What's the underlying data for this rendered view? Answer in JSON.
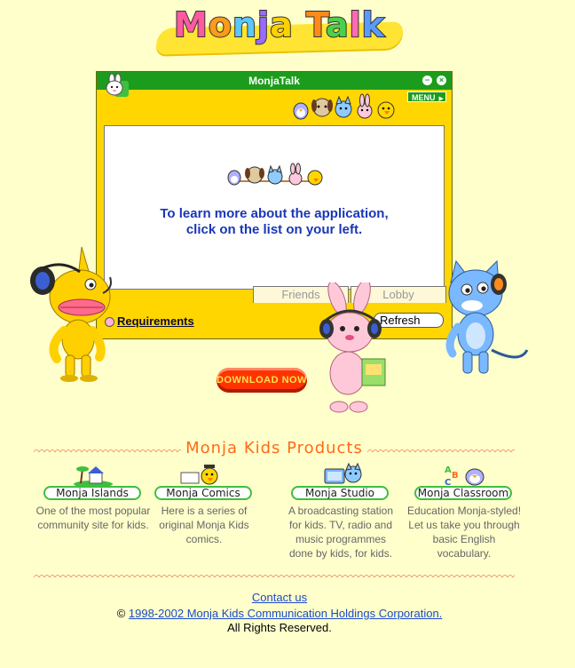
{
  "logo": {
    "text": "Monja Talk"
  },
  "app": {
    "title": "MonjaTalk",
    "menu_label": "MENU",
    "minimize_glyph": "−",
    "close_glyph": "×",
    "info_line1": "To learn more about the application,",
    "info_line2": "click on the list on your left.",
    "tabs": [
      "Friends",
      "Lobby"
    ],
    "requirements_label": "Requirements",
    "refresh_label": "Refresh"
  },
  "download_label": "DOWNLOAD NOW",
  "products": {
    "title": "Monja Kids Products",
    "items": [
      {
        "name": "Monja Islands",
        "desc": "One of the most popular community site for kids.",
        "icon": "island-icon"
      },
      {
        "name": "Monja Comics",
        "desc": "Here is a series of original Monja Kids comics.",
        "icon": "comics-icon"
      },
      {
        "name": "Monja Studio",
        "desc": "A broadcasting station for kids. TV, radio and music programmes done by kids, for kids.",
        "icon": "tv-studio-icon"
      },
      {
        "name": "Monja Classroom",
        "desc": "Education Monja-styled! Let us take you through basic English vocabulary.",
        "icon": "abc-classroom-icon"
      }
    ]
  },
  "footer": {
    "contact": "Contact us",
    "copyright_symbol": "©",
    "copyright_link": "1998-2002 Monja Kids Communication Holdings Corporation.",
    "rights": "All Rights Reserved."
  },
  "colors": {
    "background": "#ffffcc",
    "window_yellow": "#ffd600",
    "titlebar_green": "#1c9c1c",
    "info_blue": "#1a37b5",
    "products_orange": "#ff6a1a",
    "download_red": "#ff3300"
  }
}
